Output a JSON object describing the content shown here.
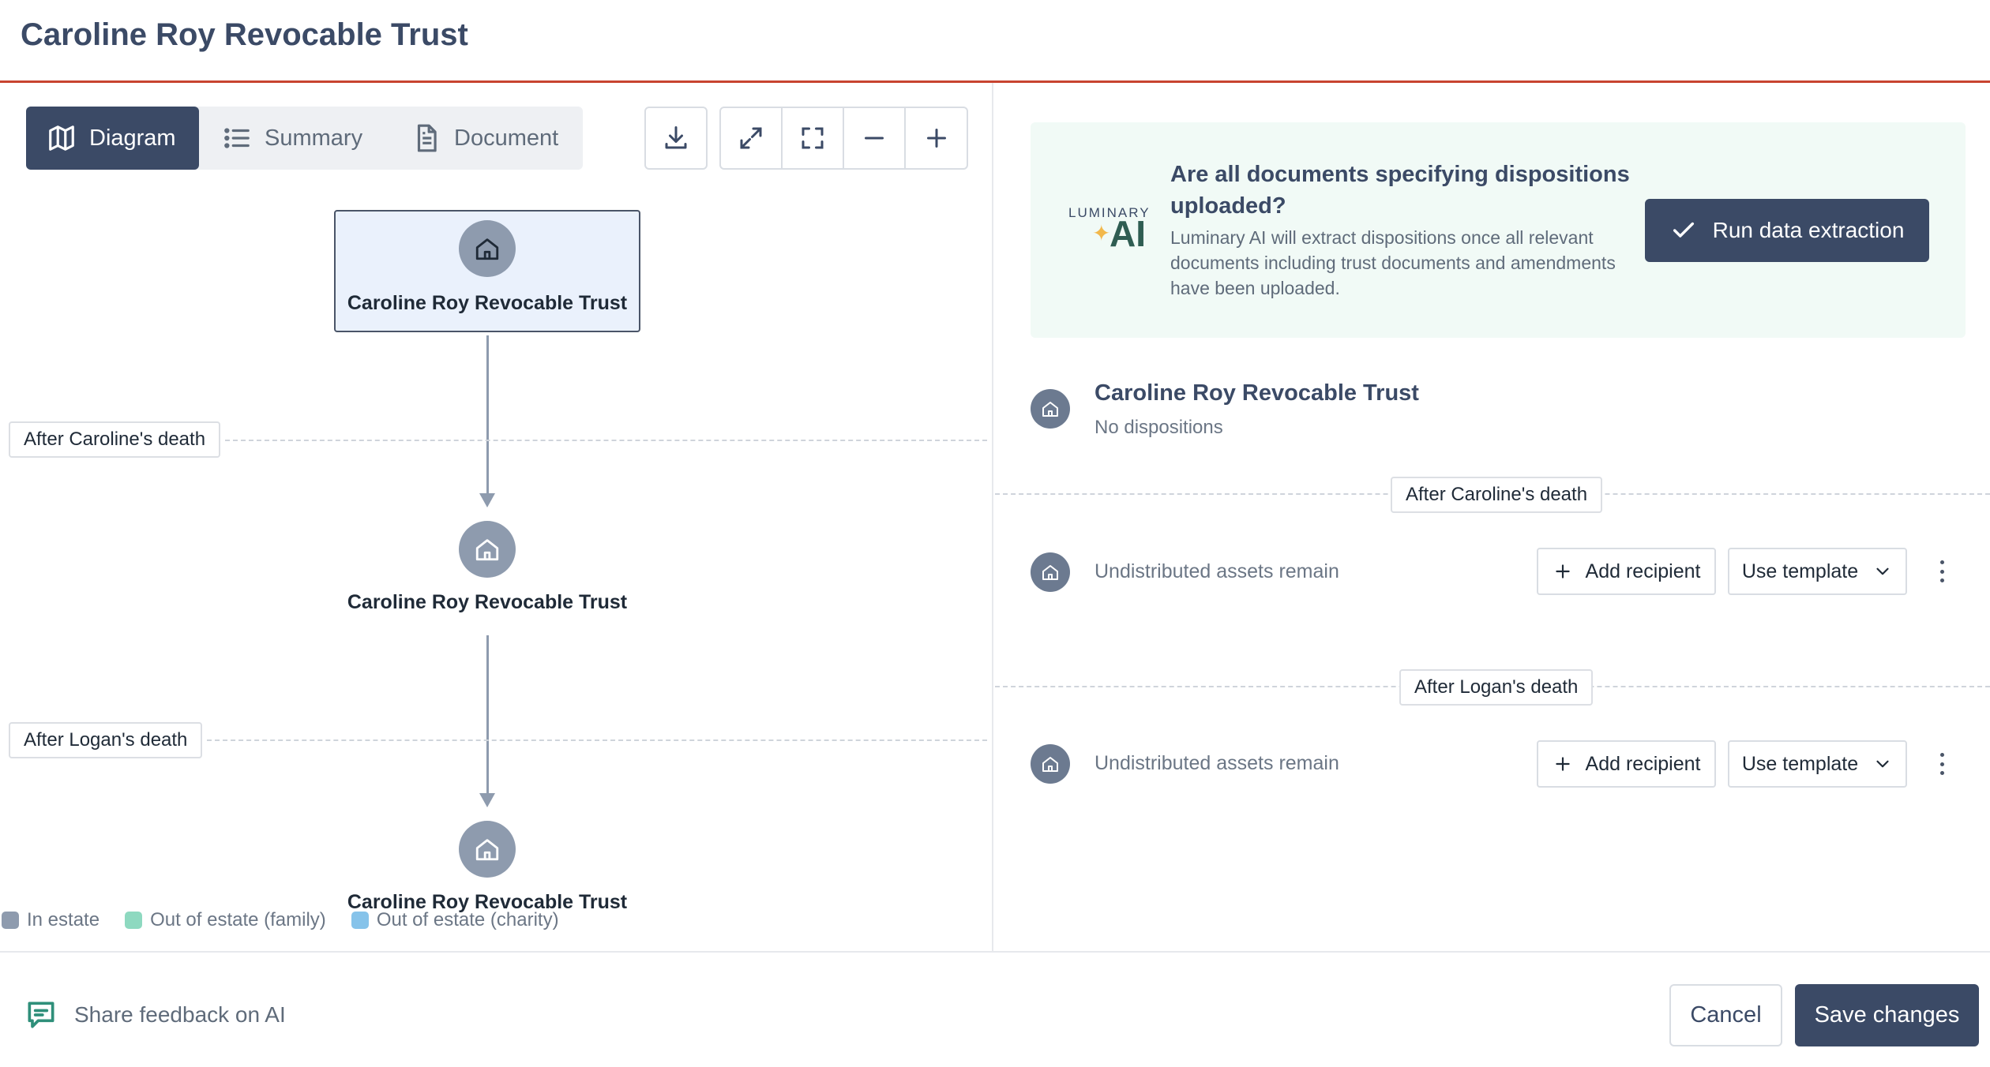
{
  "header": {
    "title": "Caroline Roy Revocable Trust"
  },
  "toolbar": {
    "tabs": [
      {
        "label": "Diagram",
        "icon": "map-icon",
        "active": true
      },
      {
        "label": "Summary",
        "icon": "list-icon",
        "active": false
      },
      {
        "label": "Document",
        "icon": "document-icon",
        "active": false
      }
    ],
    "icons": [
      "download-icon",
      "expand-icon",
      "fit-screen-icon",
      "zoom-out-icon",
      "zoom-in-icon"
    ]
  },
  "diagram": {
    "nodes": [
      {
        "label": "Caroline Roy Revocable Trust",
        "icon": "home-icon"
      },
      {
        "label": "Caroline Roy Revocable Trust",
        "icon": "home-icon"
      },
      {
        "label": "Caroline Roy Revocable Trust",
        "icon": "home-icon"
      }
    ],
    "events": [
      "After Caroline's death",
      "After Logan's death"
    ],
    "legend": [
      {
        "label": "In estate",
        "color": "#8e9bae"
      },
      {
        "label": "Out of estate (family)",
        "color": "#8ed9c0"
      },
      {
        "label": "Out of estate (charity)",
        "color": "#86c3ea"
      }
    ]
  },
  "ai_banner": {
    "brand_small": "LUMINARY",
    "brand_ai": "AI",
    "title": "Are all documents specifying dispositions uploaded?",
    "description": "Luminary AI will extract dispositions once all relevant documents including trust documents and amendments have been uploaded.",
    "button_label": "Run data extraction"
  },
  "dispositions": {
    "trust_name": "Caroline Roy Revocable Trust",
    "no_dispositions": "No dispositions",
    "sections": [
      {
        "event": "After Caroline's death",
        "status": "Undistributed assets remain",
        "add_label": "Add recipient",
        "template_label": "Use template"
      },
      {
        "event": "After Logan's death",
        "status": "Undistributed assets remain",
        "add_label": "Add recipient",
        "template_label": "Use template"
      }
    ]
  },
  "footer": {
    "feedback_label": "Share feedback on AI",
    "cancel_label": "Cancel",
    "save_label": "Save changes"
  },
  "colors": {
    "primary": "#3b4a66",
    "header_rule": "#c8442f",
    "banner_bg": "#f1faf6",
    "node_highlight": "#eaf1fc"
  }
}
